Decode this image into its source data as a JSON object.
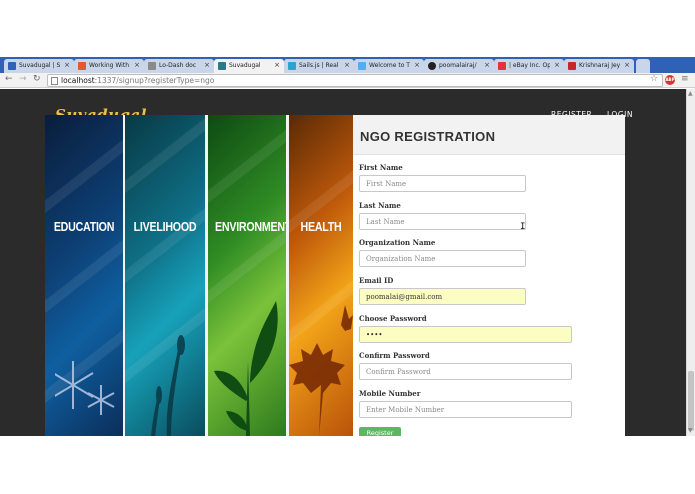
{
  "browser": {
    "tabs": [
      {
        "label": "Suvadugal | S",
        "icon_color": "#2f62b4",
        "active": false
      },
      {
        "label": "Working With",
        "icon_color": "#e05a2b",
        "active": false
      },
      {
        "label": "Lo-Dash doc",
        "icon_color": "#8a8a8a",
        "active": false
      },
      {
        "label": "Suvadugal",
        "icon_color": "#2b7a8a",
        "active": true
      },
      {
        "label": "Sails.js | Real",
        "icon_color": "#2aa6c9",
        "active": false
      },
      {
        "label": "Welcome to T",
        "icon_color": "#55acee",
        "active": false
      },
      {
        "label": "poomalairaj/",
        "icon_color": "#222222",
        "active": false
      },
      {
        "label": "| eBay Inc. Op",
        "icon_color": "#e53238",
        "active": false
      },
      {
        "label": "Krishnaraj Jeya",
        "icon_color": "#c62828",
        "active": false
      }
    ],
    "close_glyph": "×",
    "address": {
      "host": "localhost",
      "path": ":1337/signup?registerType=ngo"
    },
    "nav": {
      "back": "←",
      "forward": "→",
      "reload": "↻",
      "star": "☆",
      "menu": "≡",
      "abp": "ABP"
    }
  },
  "site": {
    "logo": "Suvadugal",
    "nav": {
      "register": "REGISTER",
      "login": "LOGIN"
    },
    "panels": [
      "EDUCATION",
      "LIVELIHOOD",
      "ENVIRONMENT",
      "HEALTH"
    ]
  },
  "form": {
    "title": "NGO REGISTRATION",
    "fields": [
      {
        "label": "First Name",
        "placeholder": "First Name",
        "value": ""
      },
      {
        "label": "Last Name",
        "placeholder": "Last Name",
        "value": ""
      },
      {
        "label": "Organization Name",
        "placeholder": "Organization Name",
        "value": ""
      },
      {
        "label": "Email ID",
        "placeholder": "Email ID",
        "value": "poomalai@gmail.com"
      },
      {
        "label": "Choose Password",
        "placeholder": "Choose Password",
        "value": "••••"
      },
      {
        "label": "Confirm Password",
        "placeholder": "Confirm Password",
        "value": ""
      },
      {
        "label": "Mobile Number",
        "placeholder": "Enter Mobile Number",
        "value": ""
      }
    ],
    "submit": "Register"
  },
  "colors": {
    "accent_gold": "#e7c34a",
    "submit_green": "#5cb85c",
    "autofill_yellow": "#fbfdc3"
  }
}
